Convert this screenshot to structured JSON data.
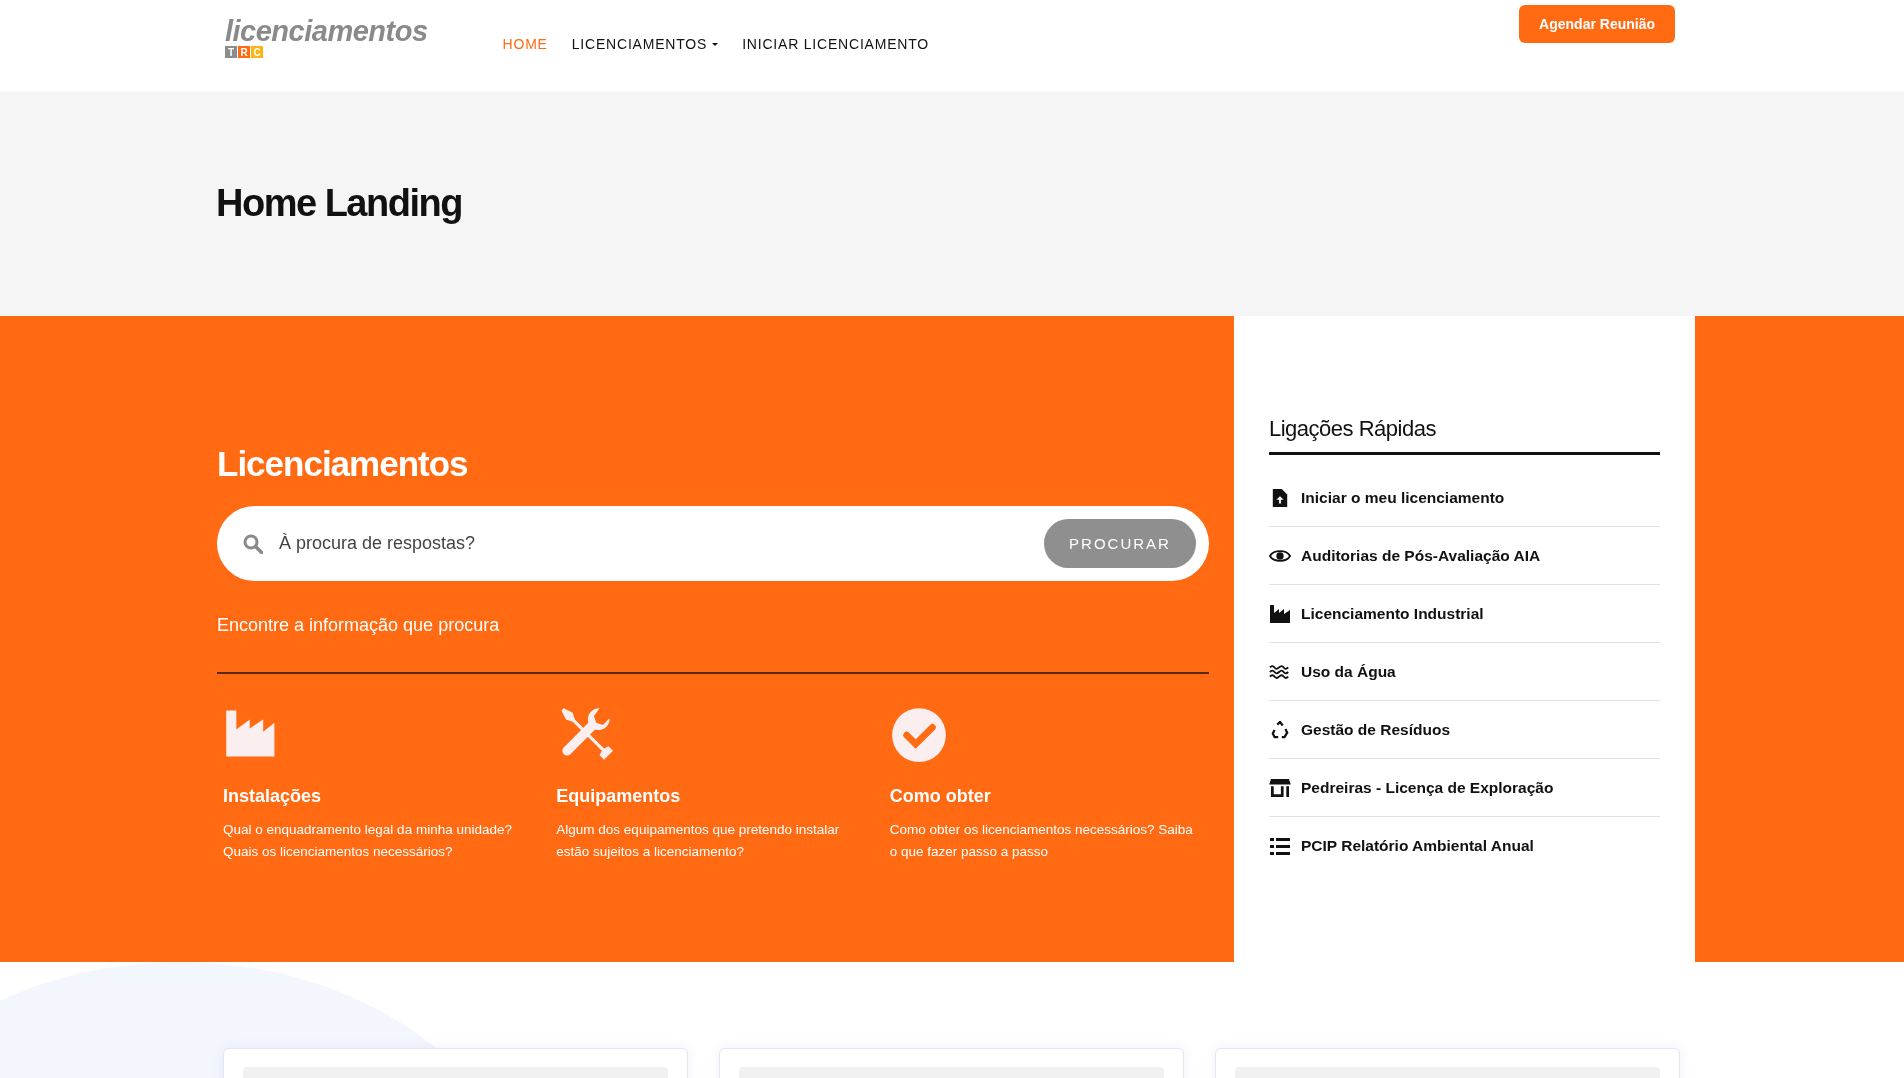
{
  "header": {
    "logo": {
      "text": "licenciamentos",
      "letters": [
        {
          "char": "T",
          "color": "#8c8c8c"
        },
        {
          "char": "R",
          "color": "#ff6a13"
        },
        {
          "char": "C",
          "color": "#fdb515"
        }
      ]
    },
    "nav": [
      {
        "label": "HOME",
        "selected": true,
        "has_menu": false
      },
      {
        "label": "LICENCIAMENTOS",
        "selected": false,
        "has_menu": true
      },
      {
        "label": "INICIAR LICENCIAMENTO",
        "selected": false,
        "has_menu": false
      }
    ],
    "cta": "Agendar Reunião"
  },
  "page_title": "Home Landing",
  "main": {
    "title": "Licenciamentos",
    "search": {
      "placeholder": "À procura de respostas?",
      "button": "PROCURAR"
    },
    "subtitle": "Encontre a informação que procura",
    "features": [
      {
        "title": "Instalações",
        "text": "Qual o enquadramento legal da minha unidade? Quais os licenciamentos necessários?"
      },
      {
        "title": "Equipamentos",
        "text": "Algum dos equipamentos que pretendo instalar estão sujeitos a licenciamento?"
      },
      {
        "title": "Como obter",
        "text": "Como obter os licenciamentos necessários? Saiba o que fazer passo a passo"
      }
    ]
  },
  "quick_links": {
    "title": "Ligações Rápidas",
    "items": [
      "Iniciar o meu licenciamento",
      "Auditorias de Pós-Avaliação AIA",
      "Licenciamento Industrial",
      "Uso da Água",
      "Gestão de Resíduos",
      "Pedreiras - Licença de Exploração",
      "PCIP Relatório Ambiental Anual"
    ]
  }
}
